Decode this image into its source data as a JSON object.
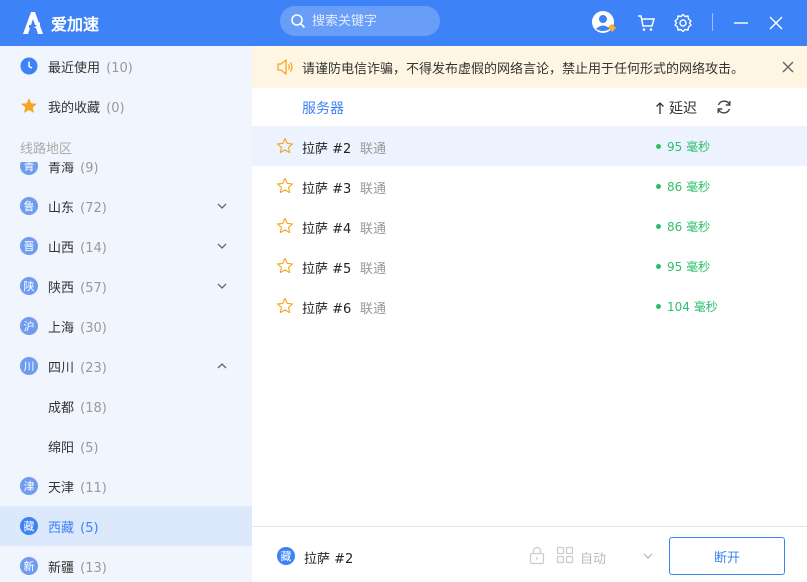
{
  "app": {
    "name": "爱加速"
  },
  "search": {
    "placeholder": "搜索关键字"
  },
  "sidebar": {
    "recent": {
      "label": "最近使用",
      "count": "(10)"
    },
    "favorites": {
      "label": "我的收藏",
      "count": "(0)"
    },
    "section_title": "线路地区",
    "regions": [
      {
        "badge": "青",
        "label": "青海",
        "count": "(9)"
      },
      {
        "badge": "鲁",
        "label": "山东",
        "count": "(72)"
      },
      {
        "badge": "晋",
        "label": "山西",
        "count": "(14)"
      },
      {
        "badge": "陕",
        "label": "陕西",
        "count": "(57)"
      },
      {
        "badge": "沪",
        "label": "上海",
        "count": "(30)"
      },
      {
        "badge": "川",
        "label": "四川",
        "count": "(23)"
      },
      {
        "badge": "",
        "label": "成都",
        "count": "(18)"
      },
      {
        "badge": "",
        "label": "绵阳",
        "count": "(5)"
      },
      {
        "badge": "津",
        "label": "天津",
        "count": "(11)"
      },
      {
        "badge": "藏",
        "label": "西藏",
        "count": "(5)"
      },
      {
        "badge": "新",
        "label": "新疆",
        "count": "(13)"
      }
    ]
  },
  "notice": {
    "text": "请谨防电信诈骗，不得发布虚假的网络言论，禁止用于任何形式的网络攻击。"
  },
  "list": {
    "col_server": "服务器",
    "col_latency": "延迟",
    "rows": [
      {
        "name": "拉萨 #2",
        "isp": "联通",
        "latency": "95 毫秒"
      },
      {
        "name": "拉萨 #3",
        "isp": "联通",
        "latency": "86 毫秒"
      },
      {
        "name": "拉萨 #4",
        "isp": "联通",
        "latency": "86 毫秒"
      },
      {
        "name": "拉萨 #5",
        "isp": "联通",
        "latency": "95 毫秒"
      },
      {
        "name": "拉萨 #6",
        "isp": "联通",
        "latency": "104 毫秒"
      }
    ]
  },
  "footer": {
    "badge": "藏",
    "server": "拉萨 #2",
    "mode": "自动",
    "disconnect": "断开"
  },
  "colors": {
    "accent": "#3e82f7",
    "latency_green": "#2fbf6a",
    "notice_bg": "#fef6e2"
  }
}
